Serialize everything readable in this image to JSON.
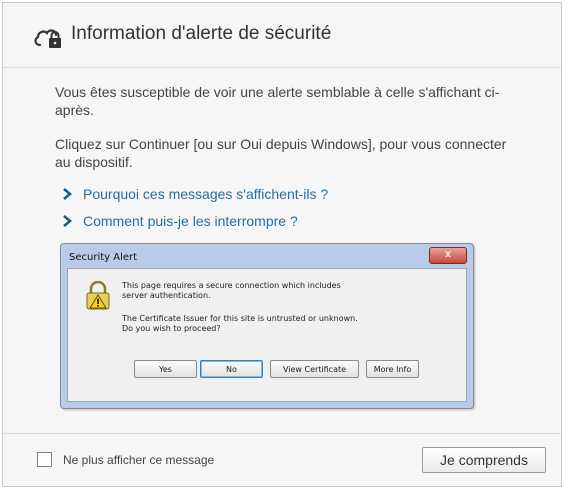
{
  "header": {
    "title": "Information d'alerte de sécurité",
    "icon": "cloud-lock-icon"
  },
  "body": {
    "paragraph1": "Vous êtes susceptible de voir une alerte semblable à celle s'affichant ci-après.",
    "paragraph2": "Cliquez sur Continuer [ou sur Oui depuis Windows], pour vous connecter au dispositif.",
    "links": [
      {
        "label": "Pourquoi ces messages s'affichent-ils ?"
      },
      {
        "label": "Comment puis-je les interrompre ?"
      }
    ]
  },
  "security_alert": {
    "title": "Security Alert",
    "close_label": "x",
    "text1": "This page requires a secure connection which includes server authentication.",
    "text2": "The Certificate Issuer for this site is untrusted or unknown.  Do you wish to proceed?",
    "buttons": {
      "yes": "Yes",
      "no": "No",
      "view": "View Certificate",
      "more": "More Info"
    }
  },
  "footer": {
    "checkbox_label": "Ne plus afficher ce message",
    "checkbox_checked": false,
    "ok_label": "Je comprends"
  },
  "colors": {
    "link": "#1f6fa8",
    "text": "#444444",
    "panel": "#f6f6f6"
  }
}
